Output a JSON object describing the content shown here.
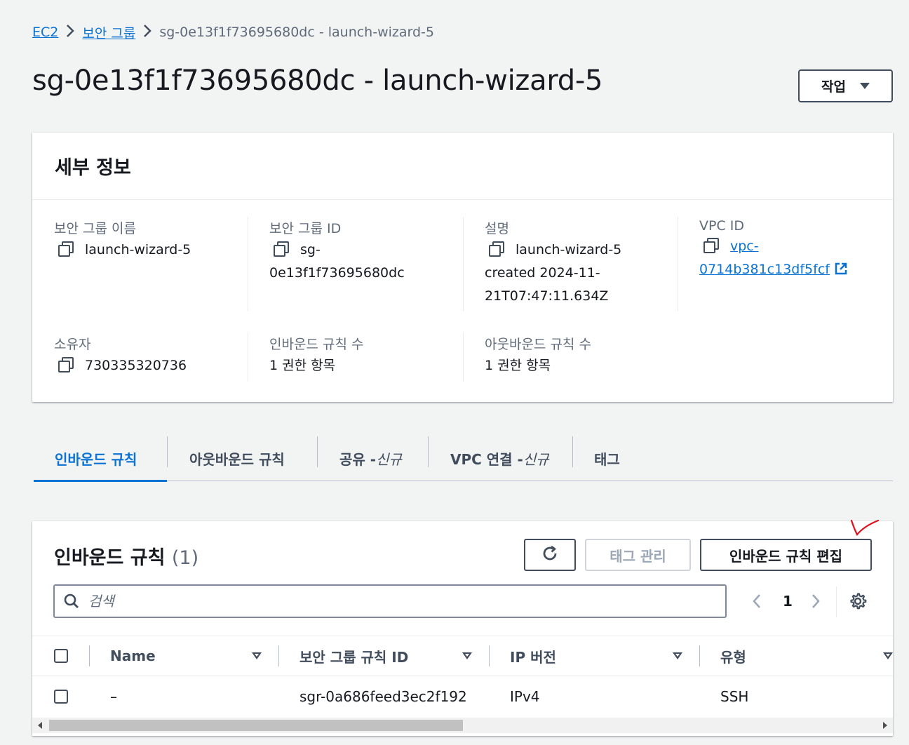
{
  "breadcrumb": {
    "items": [
      "EC2",
      "보안 그룹"
    ],
    "current": "sg-0e13f1f73695680dc - launch-wizard-5"
  },
  "page": {
    "title": "sg-0e13f1f73695680dc - launch-wizard-5",
    "actions_label": "작업"
  },
  "details": {
    "title": "세부 정보",
    "sg_name_label": "보안 그룹 이름",
    "sg_name_value": "launch-wizard-5",
    "sg_id_label": "보안 그룹 ID",
    "sg_id_value_1": "sg-",
    "sg_id_value_2": "0e13f1f73695680dc",
    "desc_label": "설명",
    "desc_line_1": "launch-wizard-5",
    "desc_line_2": "created 2024-11-",
    "desc_line_3": "21T07:47:11.634Z",
    "vpc_label": "VPC ID",
    "vpc_line_1": "vpc-",
    "vpc_line_2": "0714b381c13df5fcf",
    "owner_label": "소유자",
    "owner_value": "730335320736",
    "inbound_count_label": "인바운드 규칙 수",
    "inbound_count_value": "1 권한 항목",
    "outbound_count_label": "아웃바운드 규칙 수",
    "outbound_count_value": "1 권한 항목"
  },
  "tabs": {
    "inbound": "인바운드 규칙",
    "outbound": "아웃바운드 규칙",
    "sharing": "공유 - ",
    "sharing_new": "신규",
    "vpc_assoc": "VPC 연결 - ",
    "vpc_assoc_new": "신규",
    "tags": "태그"
  },
  "rules": {
    "title": "인바운드 규칙",
    "count": "(1)",
    "manage_tags_label": "태그 관리",
    "edit_rules_label": "인바운드 규칙 편집",
    "search_placeholder": "검색",
    "page_number": "1",
    "columns": [
      "Name",
      "보안 그룹 규칙 ID",
      "IP 버전",
      "유형"
    ],
    "rows": [
      {
        "name": "–",
        "rule_id": "sgr-0a686feed3ec2f192",
        "ip_version": "IPv4",
        "type": "SSH"
      }
    ]
  },
  "colors": {
    "link": "#0972d3",
    "annotation": "#e0101e"
  }
}
